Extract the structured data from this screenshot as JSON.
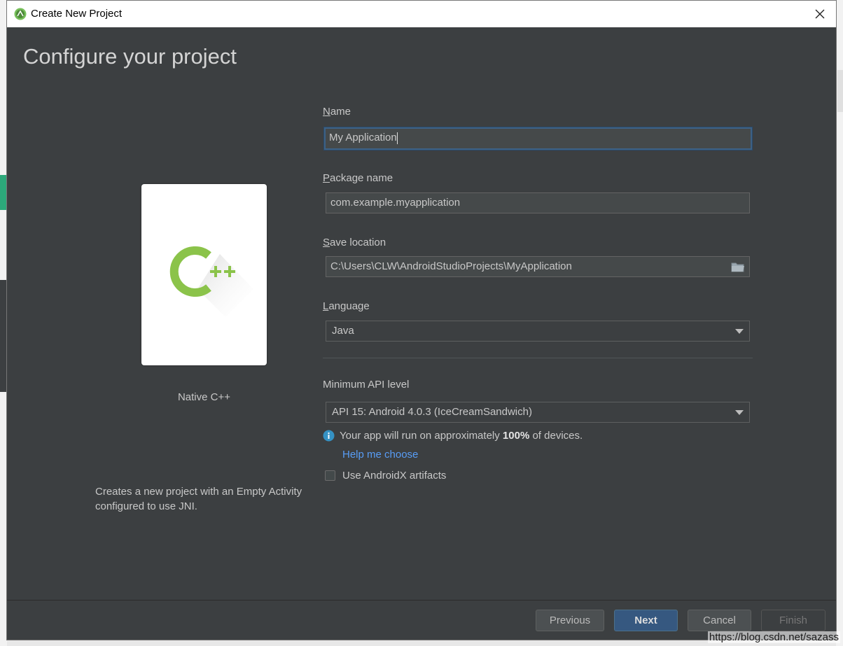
{
  "window": {
    "title": "Create New Project"
  },
  "header": {
    "title": "Configure your project"
  },
  "template": {
    "name": "Native C++",
    "description": "Creates a new project with an Empty Activity configured to use JNI.",
    "icon": "cpp-icon"
  },
  "form": {
    "name": {
      "label_mnemonic": "N",
      "label_rest": "ame",
      "value": "My Application"
    },
    "package_name": {
      "label_mnemonic": "P",
      "label_rest": "ackage name",
      "value": "com.example.myapplication"
    },
    "save_location": {
      "label_mnemonic": "S",
      "label_rest": "ave location",
      "value": "C:\\Users\\CLW\\AndroidStudioProjects\\MyApplication"
    },
    "language": {
      "label_mnemonic": "L",
      "label_rest": "anguage",
      "value": "Java"
    },
    "min_api": {
      "label": "Minimum API level",
      "value": "API 15: Android 4.0.3 (IceCreamSandwich)"
    },
    "info": {
      "prefix": "Your app will run on approximately ",
      "percent": "100%",
      "suffix": " of devices."
    },
    "help_link": "Help me choose",
    "androidx": {
      "label": "Use AndroidX artifacts",
      "checked": false
    }
  },
  "buttons": {
    "previous": "Previous",
    "next": "Next",
    "cancel": "Cancel",
    "finish": "Finish"
  },
  "watermark": "https://blog.csdn.net/sazass",
  "colors": {
    "dialog_bg": "#3c3f41",
    "accent_button": "#365880",
    "link": "#589df6",
    "cpp_green": "#8bc34a"
  }
}
